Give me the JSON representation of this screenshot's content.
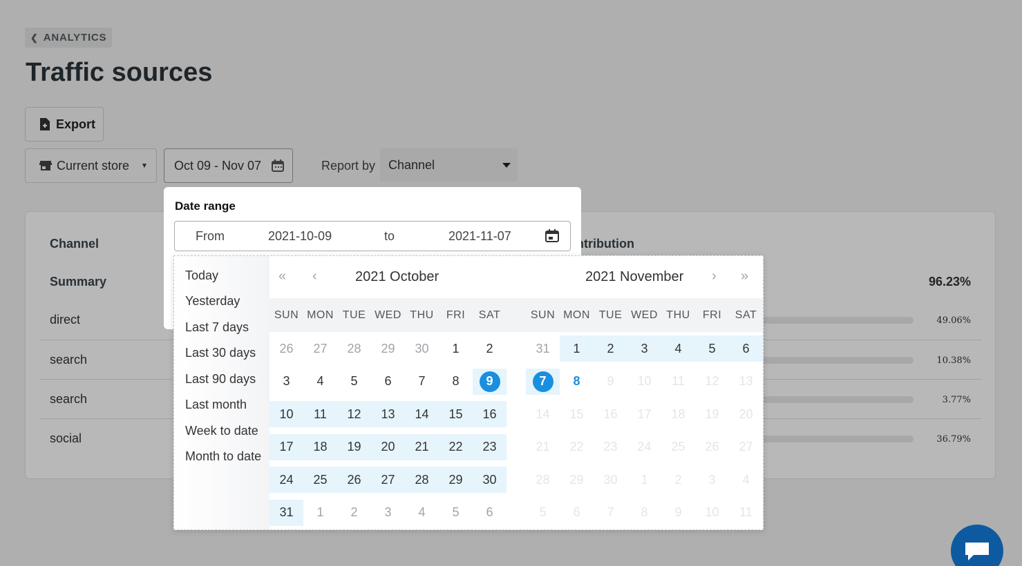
{
  "breadcrumb": {
    "label": "ANALYTICS"
  },
  "page": {
    "title": "Traffic sources"
  },
  "toolbar": {
    "export_label": "Export",
    "store_label": "Current store",
    "date_label": "Oct 09 - Nov 07",
    "report_by_label": "Report by",
    "report_by_value": "Channel"
  },
  "table": {
    "headers": {
      "channel": "Channel",
      "contribution": "Contribution"
    },
    "summary": {
      "label": "Summary",
      "value": "96.23%"
    },
    "rows": [
      {
        "label": "direct",
        "pct": "49.06%"
      },
      {
        "label": "search",
        "pct": "10.38%"
      },
      {
        "label": "search",
        "pct": "3.77%"
      },
      {
        "label": "social",
        "pct": "36.79%"
      }
    ]
  },
  "date_range": {
    "title": "Date range",
    "from_label": "From",
    "from_value": "2021-10-09",
    "to_label": "to",
    "to_value": "2021-11-07"
  },
  "presets": [
    "Today",
    "Yesterday",
    "Last 7 days",
    "Last 30 days",
    "Last 90 days",
    "Last month",
    "Week to date",
    "Month to date"
  ],
  "weekdays": [
    "SUN",
    "MON",
    "TUE",
    "WED",
    "THU",
    "FRI",
    "SAT"
  ],
  "calendar": {
    "left_title": "2021 October",
    "right_title": "2021 November",
    "left_days": [
      [
        "26",
        "27",
        "28",
        "29",
        "30",
        "1",
        "2"
      ],
      [
        "3",
        "4",
        "5",
        "6",
        "7",
        "8",
        "9"
      ],
      [
        "10",
        "11",
        "12",
        "13",
        "14",
        "15",
        "16"
      ],
      [
        "17",
        "18",
        "19",
        "20",
        "21",
        "22",
        "23"
      ],
      [
        "24",
        "25",
        "26",
        "27",
        "28",
        "29",
        "30"
      ],
      [
        "31",
        "1",
        "2",
        "3",
        "4",
        "5",
        "6"
      ]
    ],
    "right_days": [
      [
        "31",
        "1",
        "2",
        "3",
        "4",
        "5",
        "6"
      ],
      [
        "7",
        "8",
        "9",
        "10",
        "11",
        "12",
        "13"
      ],
      [
        "14",
        "15",
        "16",
        "17",
        "18",
        "19",
        "20"
      ],
      [
        "21",
        "22",
        "23",
        "24",
        "25",
        "26",
        "27"
      ],
      [
        "28",
        "29",
        "30",
        "1",
        "2",
        "3",
        "4"
      ],
      [
        "5",
        "6",
        "7",
        "8",
        "9",
        "10",
        "11"
      ]
    ],
    "selected_start": "9",
    "selected_end": "7",
    "today": "8"
  },
  "colors": {
    "accent": "#1a8fe0",
    "range_fill": "#e6f4fc",
    "chat": "#0d5aa0"
  }
}
